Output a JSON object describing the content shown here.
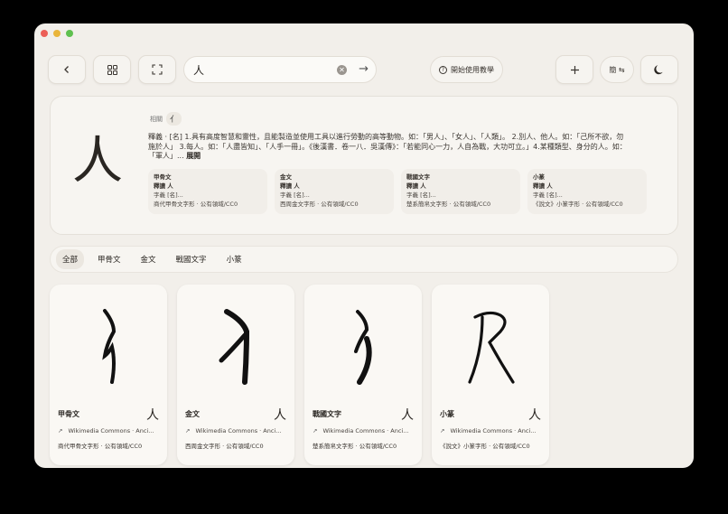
{
  "window": {
    "traffic_lights": {
      "close": "#ec5f57",
      "minimize": "#e9b53b",
      "zoom": "#5fc04f"
    }
  },
  "toolbar": {
    "back_icon": "chevron-left-icon",
    "grid_icon": "grid-icon",
    "fullscreen_icon": "expand-icon",
    "search_value": "人",
    "search_clear_icon": "x-circle-icon",
    "search_go_icon": "arrow-right-icon",
    "tutorial_label": "開始使用教學",
    "add_icon": "plus-icon",
    "convert_label": "簡 ⇆",
    "theme_icon": "moon-icon"
  },
  "entry": {
    "character": "人",
    "related_label": "相關",
    "related_char": "亻",
    "definition": "釋義 · [名] 1.具有高度智慧和靈性，且能製造並使用工具以進行勞動的高等動物。如：「男人」、「女人」、「人類」。 2.別人、他人。如：「己所不欲，勿施於人」 3.每人。如：「人盡皆知」、「人手一冊」。《後漢書．卷一八．吳漢傳》：「若能同心一力，人自為戰，大功可立。」4.某種類型、身分的人。如：「軍人」...",
    "expand_label": "展開",
    "scripts": [
      {
        "title": "甲骨文",
        "reading": "釋讀 人",
        "gloss": "字義 [名]...",
        "source": "商代甲骨文字形 · 公有領域/CC0"
      },
      {
        "title": "金文",
        "reading": "釋讀 人",
        "gloss": "字義 [名]...",
        "source": "西周金文字形 · 公有領域/CC0"
      },
      {
        "title": "戰國文字",
        "reading": "釋讀 人",
        "gloss": "字義 [名]...",
        "source": "楚系簡帛文字形 · 公有領域/CC0"
      },
      {
        "title": "小篆",
        "reading": "釋讀 人",
        "gloss": "字義 [名]...",
        "source": "《說文》小篆字形 · 公有領域/CC0"
      }
    ]
  },
  "filters": {
    "tabs": [
      "全部",
      "甲骨文",
      "金文",
      "戰國文字",
      "小篆"
    ],
    "active": "全部"
  },
  "glyph_cards": [
    {
      "title": "甲骨文",
      "char": "人",
      "source": "Wikimedia Commons · Anci...",
      "license": "商代甲骨文字形 · 公有領域/CC0",
      "glyph_icon": "oracle-bone-glyph"
    },
    {
      "title": "金文",
      "char": "人",
      "source": "Wikimedia Commons · Anci...",
      "license": "西周金文字形 · 公有領域/CC0",
      "glyph_icon": "bronze-glyph"
    },
    {
      "title": "戰國文字",
      "char": "人",
      "source": "Wikimedia Commons · Anci...",
      "license": "楚系簡帛文字形 · 公有領域/CC0",
      "glyph_icon": "warring-states-glyph"
    },
    {
      "title": "小篆",
      "char": "人",
      "source": "Wikimedia Commons · Anci...",
      "license": "《說文》小篆字形 · 公有領域/CC0",
      "glyph_icon": "seal-script-glyph"
    }
  ],
  "external_link_icon": "external-link-icon"
}
